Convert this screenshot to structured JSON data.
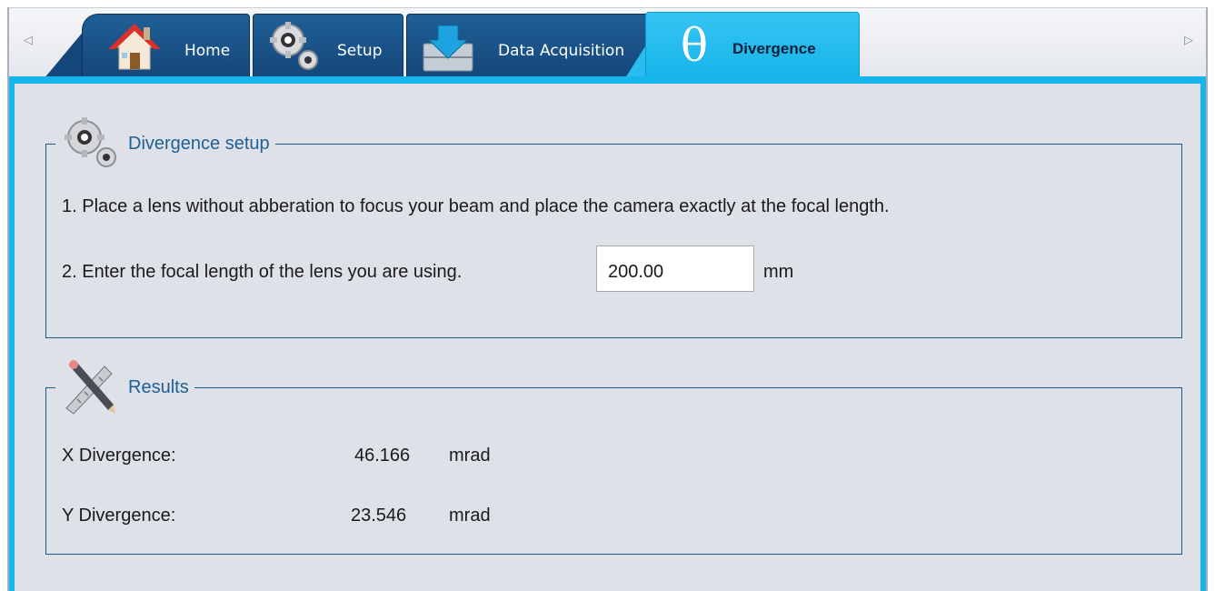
{
  "tabs": {
    "home": "Home",
    "setup": "Setup",
    "data_acquisition": "Data Acquisition",
    "divergence": "Divergence"
  },
  "divergence_setup": {
    "title": "Divergence setup",
    "step1": "1. Place a lens without abberation to focus your beam and place the camera exactly at the focal length.",
    "step2": "2. Enter the focal length of the lens you are using.",
    "focal_length_value": "200.00",
    "focal_length_unit": "mm"
  },
  "results": {
    "title": "Results",
    "x_label": "X Divergence:",
    "x_value": "46.166",
    "x_unit": "mrad",
    "y_label": "Y Divergence:",
    "y_value": "23.546",
    "y_unit": "mrad"
  },
  "colors": {
    "active_tab": "#16b5eb",
    "inactive_tab": "#15467a",
    "group_title": "#1e5f95"
  },
  "icons": {
    "scroll_left": "triangle-left-icon",
    "scroll_right": "triangle-right-icon",
    "home": "house-icon",
    "setup": "gears-icon",
    "data_acquisition": "download-database-icon",
    "divergence": "theta-icon",
    "divergence_setup": "gears-icon",
    "results": "ruler-pencil-icon"
  }
}
